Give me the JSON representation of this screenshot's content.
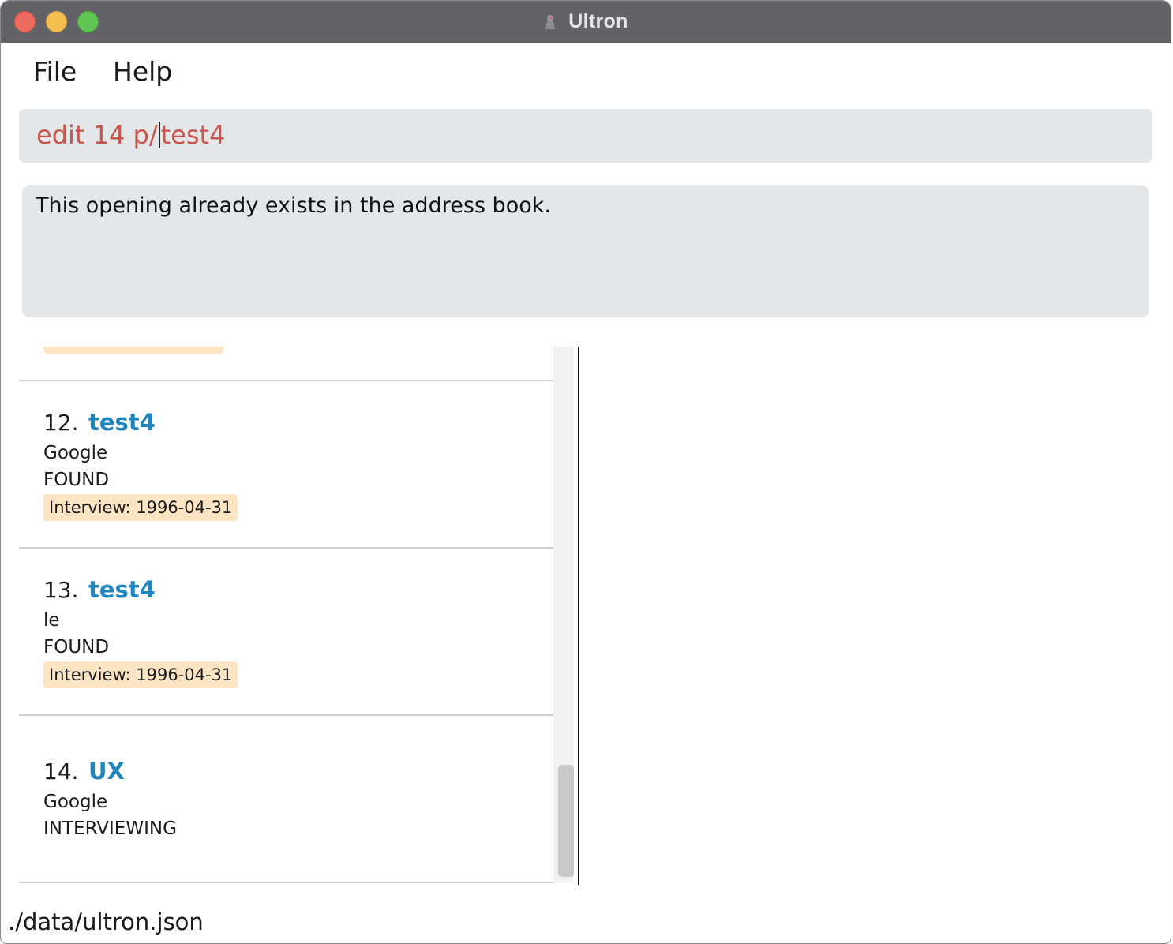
{
  "window": {
    "title": "Ultron",
    "icon": "ultron-app-icon"
  },
  "menu": {
    "items": [
      "File",
      "Help"
    ]
  },
  "command": {
    "before_caret": "edit 14 p/",
    "after_caret": "test4",
    "color": "#c9564a"
  },
  "result": {
    "message": "This opening already exists in the address book."
  },
  "openings": [
    {
      "index": "12.",
      "name": "test4",
      "company": "Google",
      "status": "FOUND",
      "tag": "Interview: 1996-04-31"
    },
    {
      "index": "13.",
      "name": "test4",
      "company": "le",
      "status": "FOUND",
      "tag": "Interview: 1996-04-31"
    },
    {
      "index": "14.",
      "name": "UX",
      "company": "Google",
      "status": "INTERVIEWING"
    }
  ],
  "status_bar": {
    "path": "./data/ultron.json"
  },
  "colors": {
    "name_accent": "#1f86bf",
    "tag_bg": "#fde5c3",
    "panel_bg": "#e4e7ea"
  }
}
